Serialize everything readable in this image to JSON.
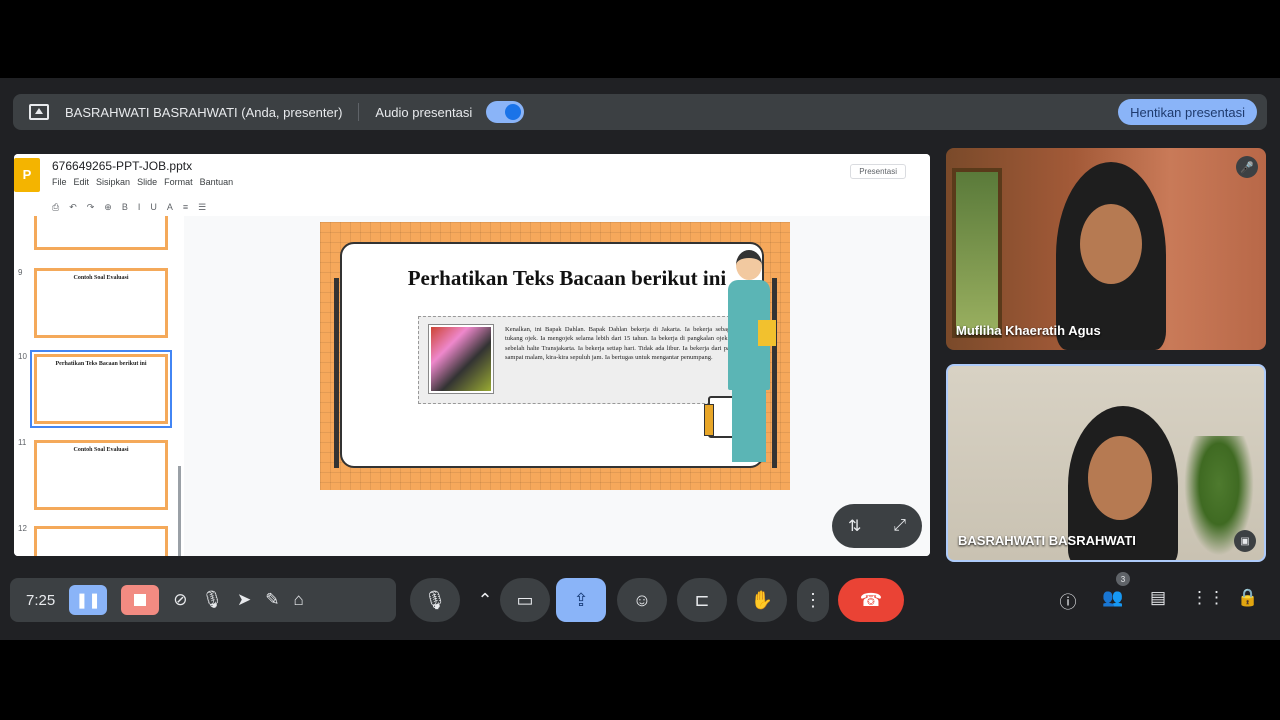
{
  "presenter_bar": {
    "presenter_label": "BASRAHWATI BASRAHWATI (Anda, presenter)",
    "audio_label": "Audio presentasi",
    "audio_on": true,
    "stop_label": "Hentikan presentasi"
  },
  "shared_screen": {
    "doc_name": "676649265-PPT-JOB.pptx",
    "logo_letter": "P",
    "menu": [
      "File",
      "Edit",
      "Sisipkan",
      "Slide",
      "Format",
      "Bantuan"
    ],
    "present_button": "Presentasi",
    "thumbnails": [
      {
        "num": "",
        "title": ""
      },
      {
        "num": "9",
        "title": "Contoh Soal Evaluasi"
      },
      {
        "num": "10",
        "title": "Perhatikan Teks Bacaan berikut ini"
      },
      {
        "num": "11",
        "title": "Contoh Soal Evaluasi"
      },
      {
        "num": "12",
        "title": ""
      }
    ],
    "slide": {
      "title": "Perhatikan Teks Bacaan berikut ini",
      "paragraph": "Kenalkan, ini Bapak Dahlan. Bapak Dahlan bekerja di Jakarta. Ia bekerja sebagai tukang ojek. Ia mengojek selama lebih dari 15 tahun. Ia bekerja di pangkalan ojek di sebelah halte Transjakarta. Ia bekerja setiap hari. Tidak ada libur. Ia bekerja dari pagi sampai malam, kira-kira sepuluh jam. Ia bertugas untuk mengantar penumpang."
    }
  },
  "participants": [
    {
      "name": "Mufliha Khaeratih Agus",
      "muted": true
    },
    {
      "name": "BASRAHWATI BASRAHWATI",
      "muted": false
    }
  ],
  "recording": {
    "time": "7:25"
  },
  "controls": {
    "participant_count": "3"
  },
  "colors": {
    "accent": "#8ab4f8",
    "end_call": "#ea4335",
    "slide_orange": "#f6a85b"
  }
}
